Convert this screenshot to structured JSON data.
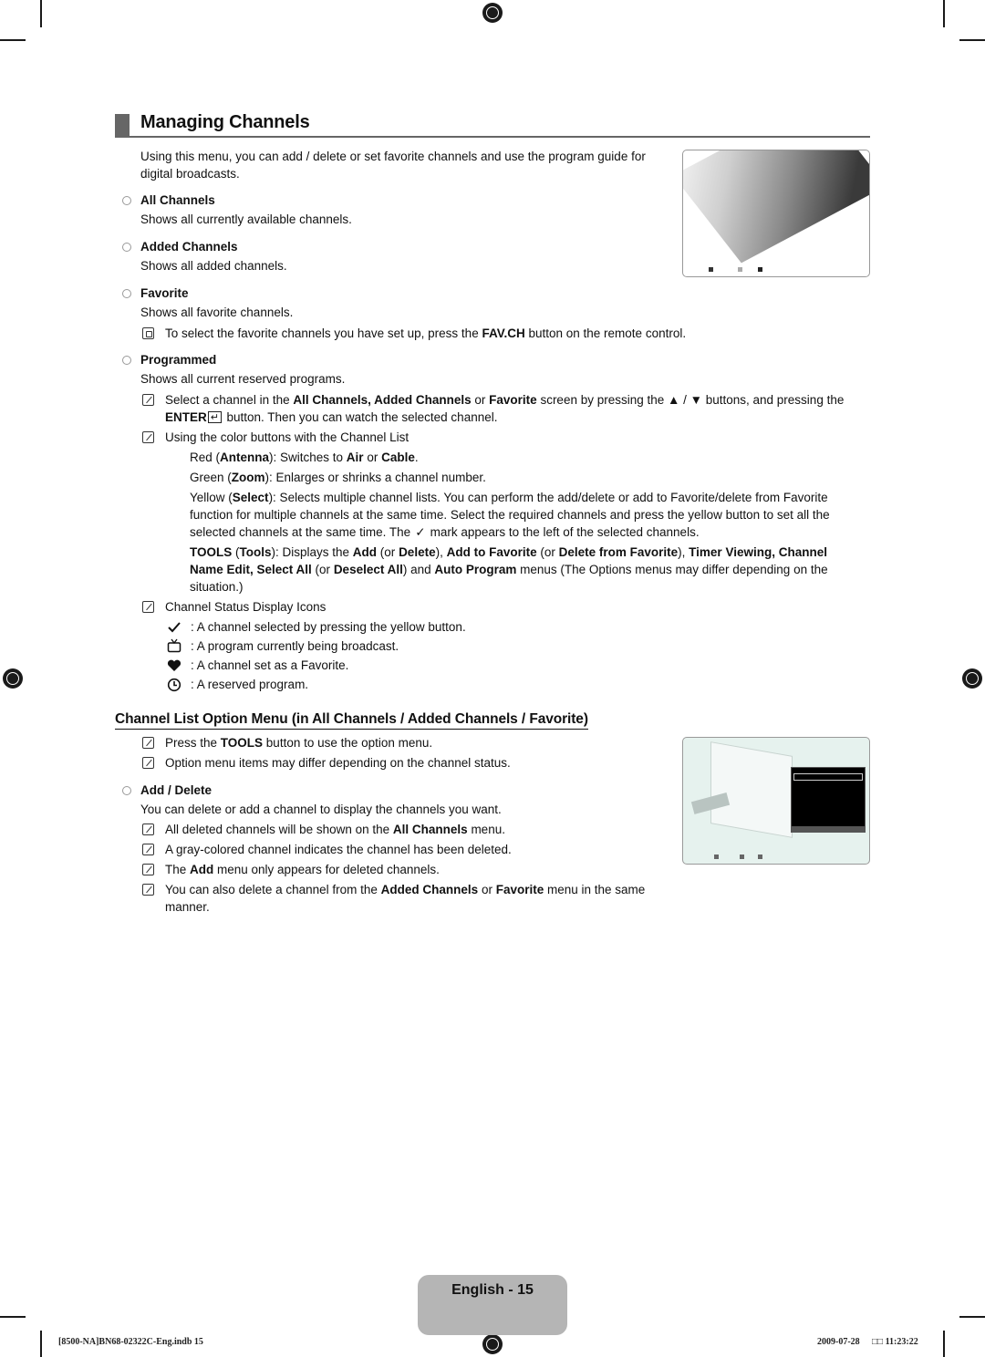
{
  "section": {
    "title": "Managing Channels",
    "intro": "Using this menu, you can add / delete or set favorite channels and use the program guide for digital broadcasts."
  },
  "items": [
    {
      "heading": "All Channels",
      "desc": "Shows all currently available channels."
    },
    {
      "heading": "Added Channels",
      "desc": "Shows all added channels."
    },
    {
      "heading": "Favorite",
      "desc": "Shows all favorite channels."
    },
    {
      "heading": "Programmed",
      "desc": "Shows all current reserved programs."
    }
  ],
  "favorite_note": {
    "pre": "To select the favorite channels you have set up, press the ",
    "bold": "FAV.CH",
    "post": " button on the remote control."
  },
  "select_note": {
    "t1": "Select a channel in the ",
    "b1": "All Channels, Added Channels",
    "t2": " or ",
    "b2": "Favorite",
    "t3": " screen by pressing the ▲ / ▼ buttons, and pressing the",
    "b3": "ENTER",
    "t4": " button. Then you can watch the selected channel."
  },
  "color_note": {
    "title": "Using the color buttons with the Channel List",
    "red": {
      "t1": "Red (",
      "b1": "Antenna",
      "t2": "): Switches to ",
      "b2": "Air",
      "t3": " or ",
      "b3": "Cable",
      "t4": "."
    },
    "green": {
      "t1": "Green (",
      "b1": "Zoom",
      "t2": "): Enlarges or shrinks a channel number."
    },
    "yellow": {
      "t1": "Yellow (",
      "b1": "Select",
      "t2": "): Selects multiple channel lists. You can perform the add/delete or add to Favorite/delete from Favorite",
      "line2": "function for multiple channels at the same time. Select the required channels and press the yellow button to set all the",
      "line3a": "selected channels at the same time. The ",
      "check": "✓",
      "line3b": " mark appears to the left of the selected channels."
    },
    "tools": {
      "b1": "TOOLS",
      "t1": " (",
      "b2": "Tools",
      "t2": "): Displays the ",
      "b3": "Add",
      "t3": " (or ",
      "b4": "Delete",
      "t4": "), ",
      "b5": "Add to Favorite",
      "t5": " (or ",
      "b6": "Delete from Favorite",
      "t6": "), ",
      "b7": "Timer Viewing, Channel",
      "b8": "Name Edit, Select All",
      "t8": " (or ",
      "b9": "Deselect All",
      "t9": ") and ",
      "b10": "Auto Program",
      "t10": " menus (The Options menus may differ depending on the",
      "t11": "situation.)"
    }
  },
  "status_icons": {
    "title": "Channel Status Display Icons",
    "list": [
      {
        "icon": "check-icon",
        "text": ": A channel selected by pressing the yellow button."
      },
      {
        "icon": "tv-icon",
        "text": ": A program currently being broadcast."
      },
      {
        "icon": "heart-icon",
        "text": ": A channel set as a Favorite."
      },
      {
        "icon": "clock-icon",
        "text": ": A reserved program."
      }
    ]
  },
  "option_menu": {
    "title": "Channel List Option Menu (in All Channels / Added Channels / Favorite)",
    "note1": {
      "t1": "Press the ",
      "b1": "TOOLS",
      "t2": " button to use the option menu."
    },
    "note2": "Option menu items may differ depending on the channel status.",
    "add_delete": {
      "heading": "Add / Delete",
      "desc": "You can delete or add a channel to display the channels you want.",
      "notes": [
        {
          "t1": "All deleted channels will be shown on the ",
          "b1": "All Channels",
          "t2": " menu."
        },
        {
          "t1": "A gray-colored channel indicates the channel has been deleted.",
          "b1": "",
          "t2": ""
        },
        {
          "t1": "The ",
          "b1": "Add",
          "t2": " menu only appears for deleted channels."
        },
        {
          "t1": "You can also delete a channel from the ",
          "b1": "Added Channels",
          "t2": " or ",
          "b2": "Favorite",
          "t3": " menu in the same",
          "t4": "manner."
        }
      ]
    }
  },
  "page": {
    "label": "English - 15"
  },
  "footer": {
    "file": "[8500-NA]BN68-02322C-Eng.indb   15",
    "date": "2009-07-28",
    "time": "□□ 11:23:22"
  }
}
